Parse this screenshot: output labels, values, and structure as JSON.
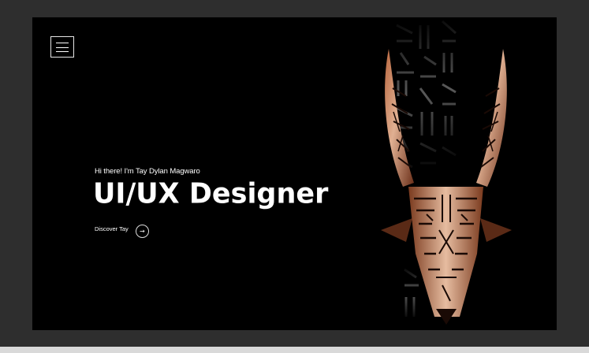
{
  "nav": {
    "menu_icon": "hamburger-menu-icon"
  },
  "hero": {
    "greeting": "Hi there! I'm Tay Dylan Magwaro",
    "headline": "UI/UX Designer",
    "cta_label": "Discover Tay",
    "cta_icon": "arrow-right-icon",
    "cta_glyph": "→"
  },
  "artwork": {
    "subject": "antelope-head-illustration",
    "colors": {
      "copper_light": "#d9a27a",
      "copper_dark": "#5a2a16",
      "background": "#000000"
    }
  }
}
